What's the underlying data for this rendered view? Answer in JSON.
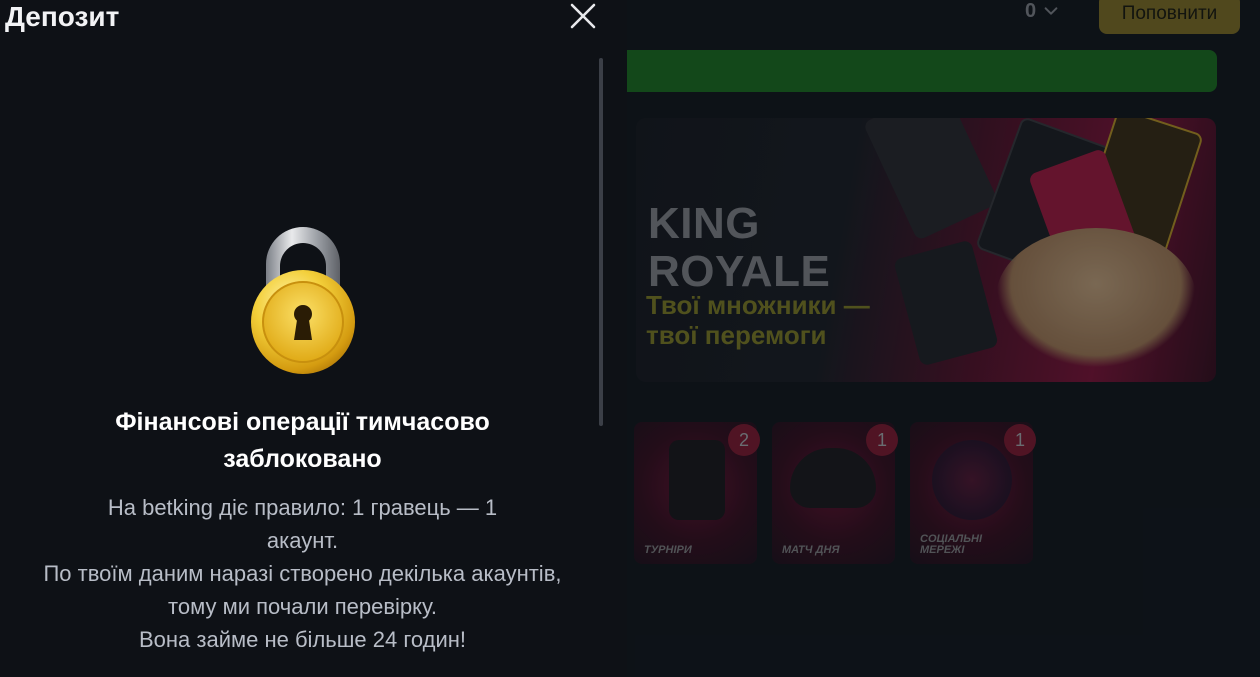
{
  "modal": {
    "title": "Депозит",
    "close_icon": "close-icon",
    "lock_icon": "padlock-icon",
    "heading": "Фінансові операції тимчасово заблоковано",
    "lines": [
      "На betking діє правило: 1 гравець — 1 акаунт.",
      "По твоїм даним наразі створено декілька акаунтів, тому ми почали перевірку.",
      "Вона займе не більше 24 годин!"
    ]
  },
  "header": {
    "balance": "0",
    "balance_icon": "chevron-down-icon",
    "deposit_label": "Поповнити"
  },
  "banner": {
    "title_line1": "KING",
    "title_line2": "ROYALE",
    "subtitle_line1": "Твої множники —",
    "subtitle_line2": "твої перемоги"
  },
  "tiles": [
    {
      "label": "ТУРНІРИ",
      "badge": "2"
    },
    {
      "label": "МАТЧ ДНЯ",
      "badge": "1"
    },
    {
      "label": "СОЦІАЛЬНІ МЕРЕЖІ",
      "badge": "1"
    }
  ],
  "colors": {
    "accent_green": "#1d7a26",
    "deposit_button": "#8a7a2a",
    "badge": "#8a1d37",
    "modal_bg": "#0e1116"
  }
}
